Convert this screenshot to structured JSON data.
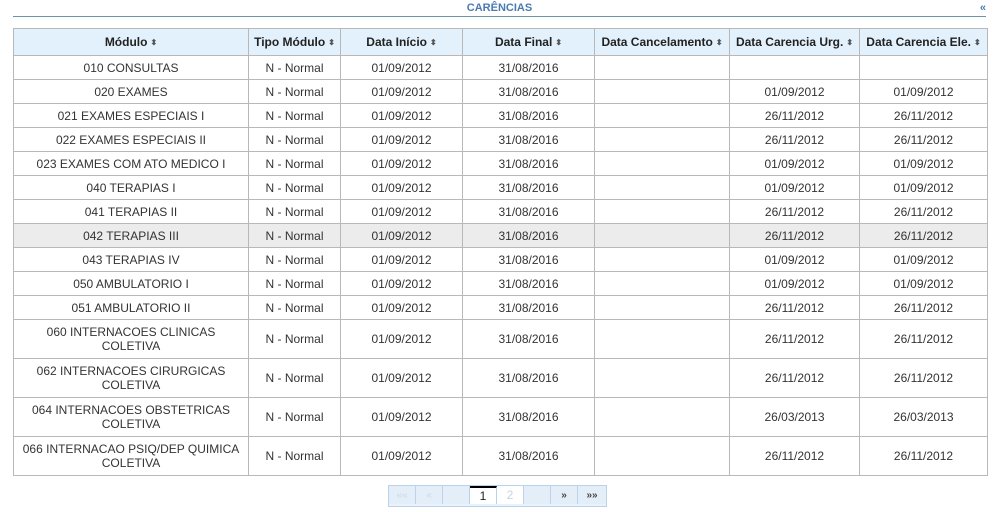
{
  "panel": {
    "title": "CARÊNCIAS",
    "collapse_label": "«"
  },
  "table": {
    "sort_icon": "⬍",
    "columns": [
      {
        "label": "Módulo"
      },
      {
        "label": "Tipo Módulo"
      },
      {
        "label": "Data Início"
      },
      {
        "label": "Data Final"
      },
      {
        "label": "Data Cancelamento"
      },
      {
        "label": "Data Carencia Urg."
      },
      {
        "label": "Data Carencia Ele."
      }
    ],
    "rows": [
      {
        "modulo": "010 CONSULTAS",
        "tipo": "N - Normal",
        "inicio": "01/09/2012",
        "final": "31/08/2016",
        "cancelamento": "",
        "urg": "",
        "ele": ""
      },
      {
        "modulo": "020 EXAMES",
        "tipo": "N - Normal",
        "inicio": "01/09/2012",
        "final": "31/08/2016",
        "cancelamento": "",
        "urg": "01/09/2012",
        "ele": "01/09/2012"
      },
      {
        "modulo": "021 EXAMES ESPECIAIS I",
        "tipo": "N - Normal",
        "inicio": "01/09/2012",
        "final": "31/08/2016",
        "cancelamento": "",
        "urg": "26/11/2012",
        "ele": "26/11/2012"
      },
      {
        "modulo": "022 EXAMES ESPECIAIS II",
        "tipo": "N - Normal",
        "inicio": "01/09/2012",
        "final": "31/08/2016",
        "cancelamento": "",
        "urg": "26/11/2012",
        "ele": "26/11/2012"
      },
      {
        "modulo": "023 EXAMES COM ATO MEDICO I",
        "tipo": "N - Normal",
        "inicio": "01/09/2012",
        "final": "31/08/2016",
        "cancelamento": "",
        "urg": "01/09/2012",
        "ele": "01/09/2012"
      },
      {
        "modulo": "040 TERAPIAS I",
        "tipo": "N - Normal",
        "inicio": "01/09/2012",
        "final": "31/08/2016",
        "cancelamento": "",
        "urg": "01/09/2012",
        "ele": "01/09/2012"
      },
      {
        "modulo": "041 TERAPIAS II",
        "tipo": "N - Normal",
        "inicio": "01/09/2012",
        "final": "31/08/2016",
        "cancelamento": "",
        "urg": "26/11/2012",
        "ele": "26/11/2012"
      },
      {
        "modulo": "042 TERAPIAS III",
        "tipo": "N - Normal",
        "inicio": "01/09/2012",
        "final": "31/08/2016",
        "cancelamento": "",
        "urg": "26/11/2012",
        "ele": "26/11/2012"
      },
      {
        "modulo": "043 TERAPIAS IV",
        "tipo": "N - Normal",
        "inicio": "01/09/2012",
        "final": "31/08/2016",
        "cancelamento": "",
        "urg": "01/09/2012",
        "ele": "01/09/2012"
      },
      {
        "modulo": "050 AMBULATORIO I",
        "tipo": "N - Normal",
        "inicio": "01/09/2012",
        "final": "31/08/2016",
        "cancelamento": "",
        "urg": "01/09/2012",
        "ele": "01/09/2012"
      },
      {
        "modulo": "051 AMBULATORIO II",
        "tipo": "N - Normal",
        "inicio": "01/09/2012",
        "final": "31/08/2016",
        "cancelamento": "",
        "urg": "26/11/2012",
        "ele": "26/11/2012"
      },
      {
        "modulo": "060 INTERNACOES CLINICAS COLETIVA",
        "tipo": "N - Normal",
        "inicio": "01/09/2012",
        "final": "31/08/2016",
        "cancelamento": "",
        "urg": "26/11/2012",
        "ele": "26/11/2012"
      },
      {
        "modulo": "062 INTERNACOES CIRURGICAS COLETIVA",
        "tipo": "N - Normal",
        "inicio": "01/09/2012",
        "final": "31/08/2016",
        "cancelamento": "",
        "urg": "26/11/2012",
        "ele": "26/11/2012"
      },
      {
        "modulo": "064 INTERNACOES OBSTETRICAS COLETIVA",
        "tipo": "N - Normal",
        "inicio": "01/09/2012",
        "final": "31/08/2016",
        "cancelamento": "",
        "urg": "26/03/2013",
        "ele": "26/03/2013"
      },
      {
        "modulo": "066 INTERNACAO PSIQ/DEP QUIMICA COLETIVA",
        "tipo": "N - Normal",
        "inicio": "01/09/2012",
        "final": "31/08/2016",
        "cancelamento": "",
        "urg": "26/11/2012",
        "ele": "26/11/2012"
      }
    ]
  },
  "pagination": {
    "first_label": "««",
    "prev_label": "«",
    "pages": [
      "1",
      "2"
    ],
    "current_page": "1",
    "next_label": "»",
    "last_label": "»»"
  }
}
